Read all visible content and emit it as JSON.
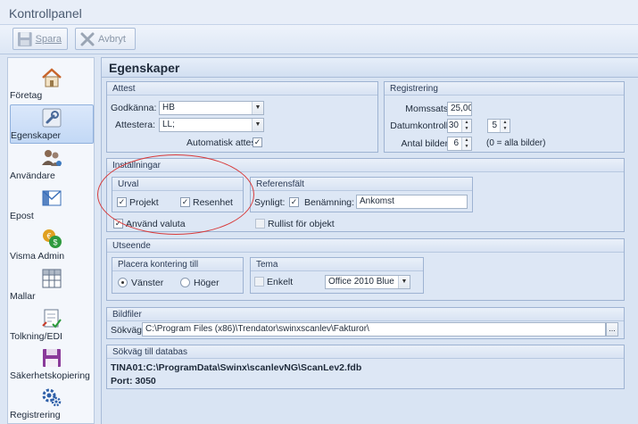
{
  "window": {
    "title": "Kontrollpanel"
  },
  "toolbar": {
    "save_label": "Spara",
    "cancel_label": "Avbryt"
  },
  "sidebar": {
    "items": [
      {
        "label": "Företag",
        "icon": "home-icon"
      },
      {
        "label": "Egenskaper",
        "icon": "wrench-icon",
        "active": true
      },
      {
        "label": "Användare",
        "icon": "users-icon"
      },
      {
        "label": "Epost",
        "icon": "email-icon"
      },
      {
        "label": "Visma Admin",
        "icon": "coins-icon"
      },
      {
        "label": "Mallar",
        "icon": "table-icon"
      },
      {
        "label": "Tolkning/EDI",
        "icon": "document-check-icon"
      },
      {
        "label": "Säkerhetskopiering",
        "icon": "floppy-icon"
      },
      {
        "label": "Registrering",
        "icon": "gears-icon"
      }
    ]
  },
  "main": {
    "title": "Egenskaper",
    "attest": {
      "header": "Attest",
      "godkanna_label": "Godkänna:",
      "godkanna_value": "HB",
      "attestera_label": "Attestera:",
      "attestera_value": "LL;",
      "auto_label": "Automatisk attest",
      "auto_checked": true
    },
    "registrering": {
      "header": "Registrering",
      "momssats_label": "Momssats:",
      "momssats_value": "25,00",
      "datumkontroll_label": "Datumkontroll:",
      "datumkontroll_value1": "30",
      "datumkontroll_value2": "5",
      "antal_label": "Antal bilder:",
      "antal_value": "6",
      "antal_hint": "(0 = alla bilder)"
    },
    "installningar": {
      "header": "Inställningar",
      "urval": {
        "header": "Urval",
        "projekt_label": "Projekt",
        "resenhet_label": "Resenhet"
      },
      "anvand_valuta_label": "Använd valuta",
      "referensfalt": {
        "header": "Referensfält",
        "synligt_label": "Synligt:",
        "benamning_label": "Benämning:",
        "benamning_value": "Ankomst"
      },
      "rullist_label": "Rullist för objekt"
    },
    "utseende": {
      "header": "Utseende",
      "placera": {
        "header": "Placera kontering till",
        "vanster_label": "Vänster",
        "hoger_label": "Höger"
      },
      "tema": {
        "header": "Tema",
        "enkelt_label": "Enkelt",
        "theme_value": "Office 2010 Blue"
      }
    },
    "bildfiler": {
      "header": "Bildfiler",
      "sokvag_label": "Sökväg:",
      "sokvag_value": "C:\\Program Files (x86)\\Trendator\\swinxscanlev\\Fakturor\\",
      "browse_label": "..."
    },
    "databas": {
      "header": "Sökväg till databas",
      "path": "TINA01:C:\\ProgramData\\Swinx\\scanlevNG\\ScanLev2.fdb",
      "port": "Port: 3050"
    }
  },
  "colors": {
    "accent": "#1c4fa8",
    "annotation": "#d83a3a"
  }
}
